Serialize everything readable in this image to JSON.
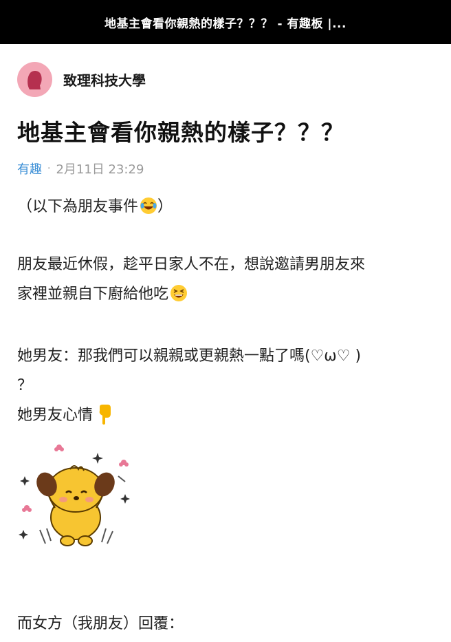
{
  "header": {
    "title": "地基主會看你親熱的樣子？？？ - 有趣板 |..."
  },
  "author": {
    "school": "致理科技大學",
    "avatar_icon": "female-avatar-icon",
    "avatar_color": "#f3a7b6"
  },
  "post": {
    "title": "地基主會看你親熱的樣子？？？",
    "board": "有趣",
    "separator": "·",
    "timestamp": "2月11日 23:29",
    "paragraphs": {
      "p1": "（以下為朋友事件",
      "p1_end": "）",
      "p2_line1": "朋友最近休假，趁平日家人不在，想說邀請男朋友來",
      "p2_line2": "家裡並親自下廚給他吃",
      "p3_line1": "她男友：那我們可以親親或更親熱一點了嗎(♡ω♡ )",
      "p3_line2": "？",
      "p3_line3": "她男友心情",
      "p4": "而女方（我朋友）回覆："
    },
    "emojis": [
      "laughing-tears-emoji",
      "grinning-squint-emoji",
      "pointing-down-emoji"
    ],
    "sticker": "happy-dog-sticker"
  },
  "colors": {
    "topbar": "#000000",
    "board_link": "#3c8fd6",
    "meta": "#9a9a9a"
  }
}
